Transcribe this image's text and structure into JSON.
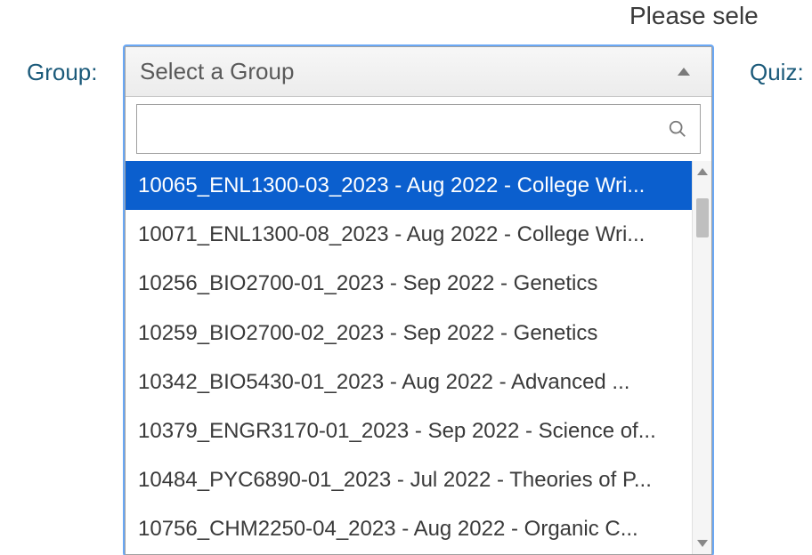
{
  "header": {
    "partial_text": "Please sele"
  },
  "labels": {
    "group": "Group:",
    "quiz": "Quiz:"
  },
  "dropdown": {
    "placeholder": "Select a Group",
    "search_placeholder": "",
    "options": [
      {
        "label": "10065_ENL1300-03_2023 - Aug 2022 - College Wri...",
        "highlighted": true
      },
      {
        "label": "10071_ENL1300-08_2023 - Aug 2022 - College Wri...",
        "highlighted": false
      },
      {
        "label": "10256_BIO2700-01_2023 - Sep 2022 - Genetics",
        "highlighted": false
      },
      {
        "label": "10259_BIO2700-02_2023 - Sep 2022 - Genetics",
        "highlighted": false
      },
      {
        "label": "10342_BIO5430-01_2023 - Aug 2022 - Advanced ...",
        "highlighted": false
      },
      {
        "label": "10379_ENGR3170-01_2023 - Sep 2022 - Science of...",
        "highlighted": false
      },
      {
        "label": "10484_PYC6890-01_2023 - Jul 2022 - Theories of P...",
        "highlighted": false
      },
      {
        "label": "10756_CHM2250-04_2023 - Aug 2022 - Organic C...",
        "highlighted": false
      }
    ]
  }
}
